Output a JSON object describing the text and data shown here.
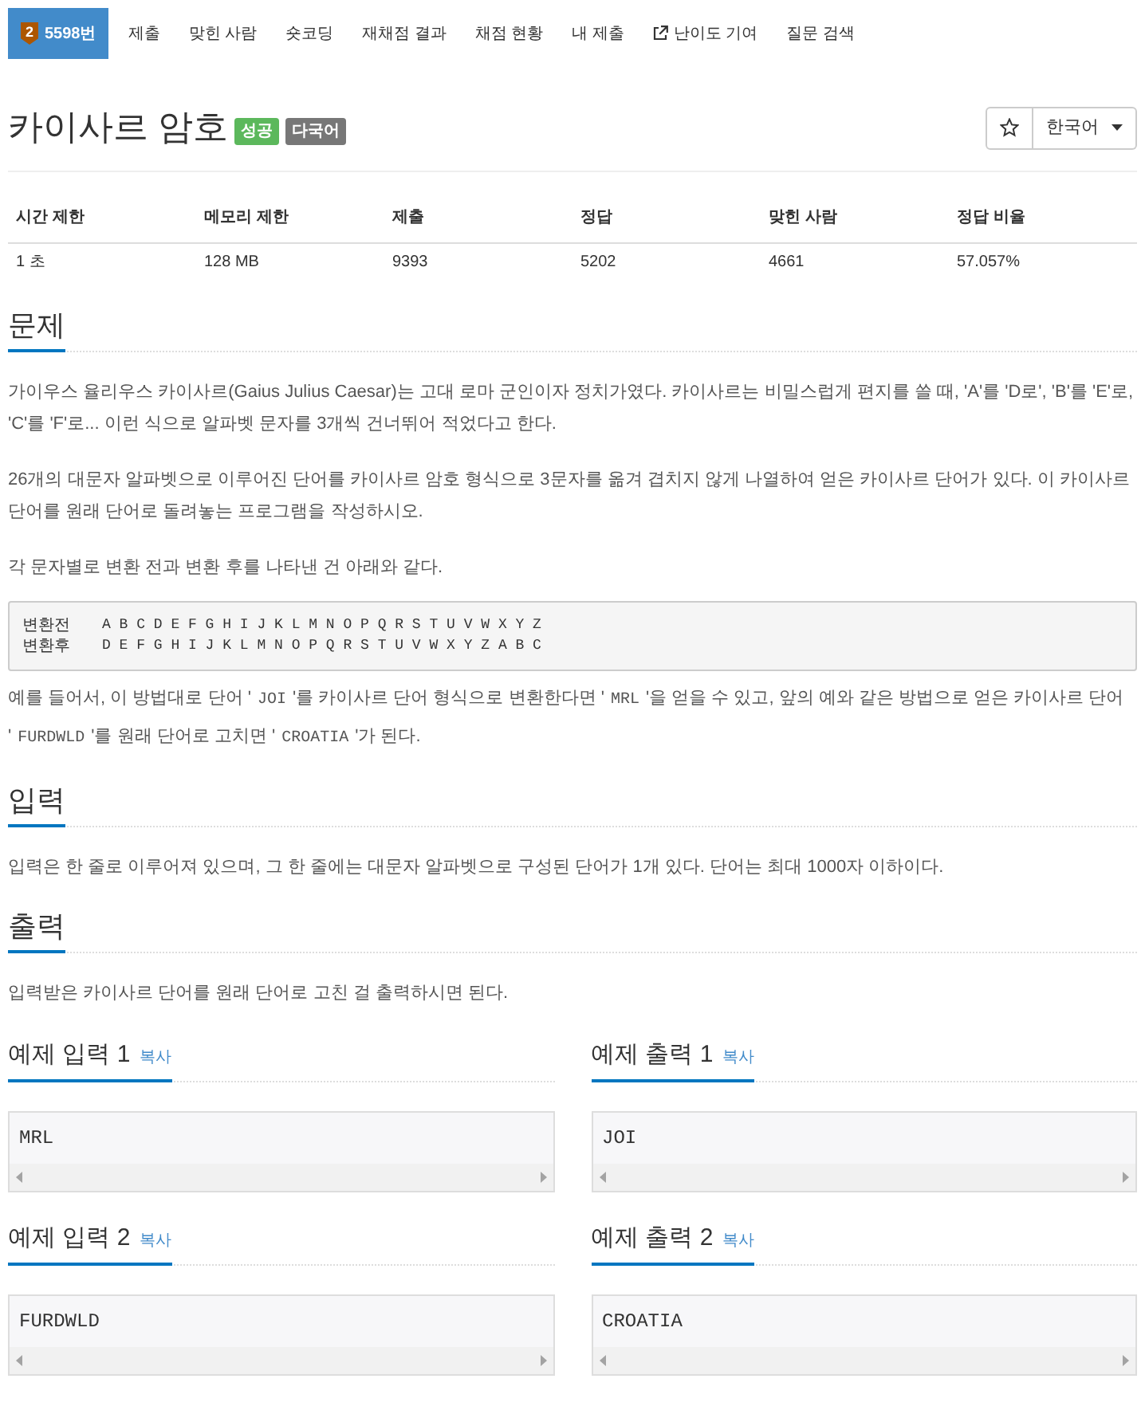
{
  "nav": [
    {
      "label": "5598번",
      "selected": true,
      "tier": "2",
      "external": false
    },
    {
      "label": "제출",
      "selected": false,
      "external": false
    },
    {
      "label": "맞힌 사람",
      "selected": false,
      "external": false
    },
    {
      "label": "숏코딩",
      "selected": false,
      "external": false
    },
    {
      "label": "재채점 결과",
      "selected": false,
      "external": false
    },
    {
      "label": "채점 현황",
      "selected": false,
      "external": false
    },
    {
      "label": "내 제출",
      "selected": false,
      "external": false
    },
    {
      "label": "난이도 기여",
      "selected": false,
      "external": true
    },
    {
      "label": "질문 검색",
      "selected": false,
      "external": false
    }
  ],
  "title": "카이사르 암호",
  "title_badges": [
    {
      "label": "성공",
      "color": "#5cb85c"
    },
    {
      "label": "다국어",
      "color": "#777777"
    }
  ],
  "starred": false,
  "language": "한국어",
  "stats": {
    "columns": [
      "시간 제한",
      "메모리 제한",
      "제출",
      "정답",
      "맞힌 사람",
      "정답 비율"
    ],
    "rows": [
      [
        "1 초",
        "128 MB",
        "9393",
        "5202",
        "4661",
        "57.057%"
      ]
    ]
  },
  "sections": [
    {
      "title": "문제",
      "blocks": [
        {
          "kind": "paragraph",
          "segments": [
            {
              "kind": "text",
              "text": "가이우스 율리우스 카이사르(Gaius Julius Caesar)는 고대 로마 군인이자 정치가였다. 카이사르는 비밀스럽게 편지를 쓸 때, 'A'를 'D로', 'B'를 'E'로, 'C'를 'F'로... 이런 식으로 알파벳 문자를 3개씩 건너뛰어 적었다고 한다."
            }
          ]
        },
        {
          "kind": "paragraph",
          "segments": [
            {
              "kind": "text",
              "text": "26개의 대문자 알파벳으로 이루어진 단어를 카이사르 암호 형식으로 3문자를 옮겨 겹치지 않게 나열하여 얻은 카이사르 단어가 있다. 이 카이사르 단어를 원래 단어로 돌려놓는 프로그램을 작성하시오."
            }
          ]
        },
        {
          "kind": "paragraph",
          "segments": [
            {
              "kind": "text",
              "text": "각 문자별로 변환 전과 변환 후를 나타낸 건 아래와 같다."
            }
          ]
        },
        {
          "kind": "mapping",
          "rows": [
            {
              "label": "변환전",
              "letters": "A B C D E F G H I J K L M N O P Q R S T U V W X Y Z"
            },
            {
              "label": "변환후",
              "letters": "D E F G H I J K L M N O P Q R S T U V W X Y Z A B C"
            }
          ]
        },
        {
          "kind": "paragraph",
          "segments": [
            {
              "kind": "text",
              "text": "예를 들어서, 이 방법대로 단어 '"
            },
            {
              "kind": "code",
              "text": "JOI"
            },
            {
              "kind": "text",
              "text": "'를 카이사르 단어 형식으로 변환한다면 '"
            },
            {
              "kind": "code",
              "text": "MRL"
            },
            {
              "kind": "text",
              "text": "'을 얻을 수 있고, 앞의 예와 같은 방법으로 얻은 카이사르 단어 '"
            },
            {
              "kind": "code",
              "text": "FURDWLD"
            },
            {
              "kind": "text",
              "text": "'를 원래 단어로 고치면 '"
            },
            {
              "kind": "code",
              "text": "CROATIA"
            },
            {
              "kind": "text",
              "text": "'가 된다."
            }
          ]
        }
      ]
    },
    {
      "title": "입력",
      "blocks": [
        {
          "kind": "paragraph",
          "segments": [
            {
              "kind": "text",
              "text": "입력은 한 줄로 이루어져 있으며, 그 한 줄에는 대문자 알파벳으로 구성된 단어가 1개 있다. 단어는 최대 1000자 이하이다."
            }
          ]
        }
      ]
    },
    {
      "title": "출력",
      "blocks": [
        {
          "kind": "paragraph",
          "segments": [
            {
              "kind": "text",
              "text": "입력받은 카이사르 단어를 원래 단어로 고친 걸 출력하시면 된다."
            }
          ]
        }
      ]
    }
  ],
  "samples": [
    {
      "title": "예제 입력 1",
      "copy": "복사",
      "data": "MRL"
    },
    {
      "title": "예제 출력 1",
      "copy": "복사",
      "data": "JOI"
    },
    {
      "title": "예제 입력 2",
      "copy": "복사",
      "data": "FURDWLD"
    },
    {
      "title": "예제 출력 2",
      "copy": "복사",
      "data": "CROATIA"
    }
  ]
}
